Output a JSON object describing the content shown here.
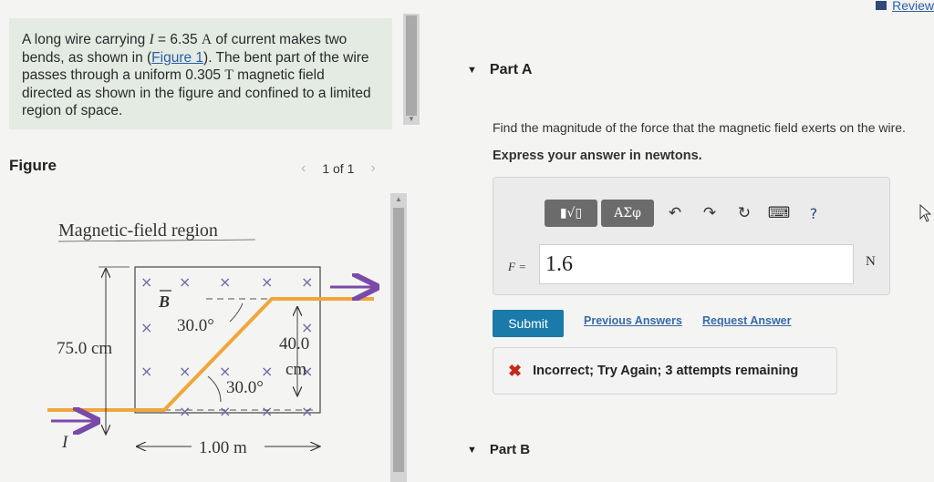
{
  "problem": {
    "prefix": "A long wire carrying",
    "current_var": "I",
    "current_eq": " = 6.35 ",
    "current_unit": "A",
    "line1_suffix": " of current makes two",
    "line2_a": "bends, as shown in (",
    "figure_link": "Figure 1",
    "line2_b": "). The bent part of the wire",
    "line3_a": "passes through a uniform 0.305 ",
    "field_unit": "T",
    "line3_b": " magnetic field",
    "line4": "directed as shown in the figure and confined to a limited",
    "line5": "region of space."
  },
  "figure": {
    "header": "Figure",
    "pager": "1 of 1",
    "region_label": "Magnetic-field region",
    "field_symbol": "B",
    "angle_top": "30.0°",
    "angle_bottom": "30.0°",
    "height_label": "75.0 cm",
    "inner_label_value": "40.0",
    "inner_label_unit": "cm",
    "width_label": "1.00 m",
    "current_label": "I"
  },
  "header": {
    "review_label": "Review"
  },
  "part_a": {
    "title": "Part A",
    "question": "Find the magnitude of the force that the magnetic field exerts on the wire.",
    "instructions": "Express your answer in newtons.",
    "toolbar": {
      "template_label": "▮√▯",
      "greek_label": "ΑΣφ",
      "undo": "↶",
      "redo": "↷",
      "reset": "↻",
      "keyboard": "⌨",
      "help": "?"
    },
    "var_label": "F =",
    "answer_value": "1.6",
    "unit": "N",
    "submit_label": "Submit",
    "previous_answers": "Previous Answers",
    "request_answer": "Request Answer",
    "feedback": "Incorrect; Try Again; 3 attempts remaining"
  },
  "part_b": {
    "title": "Part B"
  },
  "colors": {
    "wire": "#f0a63a",
    "arrow": "#7a4aa8",
    "submit": "#1a7aaa",
    "link": "#2d5ea8",
    "error": "#c52a1a"
  }
}
